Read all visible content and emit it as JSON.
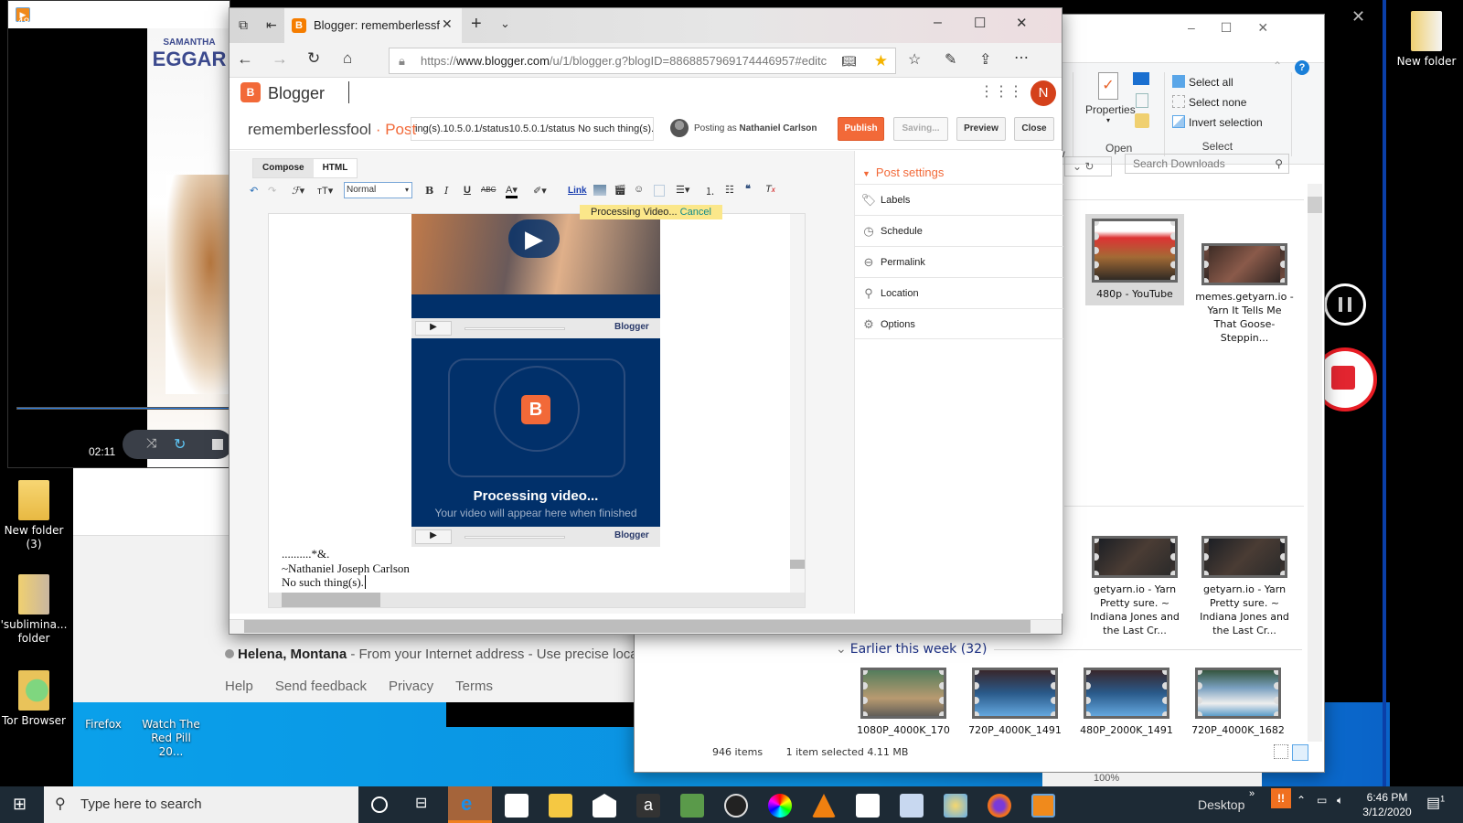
{
  "player": {
    "title": "480p - YouTube",
    "time": "02:11",
    "poster_text_1": "SAMANTHA",
    "poster_text_2": "EGGAR",
    "progress": 1.0
  },
  "desktop": {
    "left_icons": [
      {
        "label": "New folder (3)"
      },
      {
        "label": "'sublimina... folder"
      },
      {
        "label": "Tor Browser"
      }
    ],
    "bottom_icons": [
      {
        "label": "Firefox"
      },
      {
        "label": "Watch The Red Pill 20..."
      }
    ],
    "right_icons": [
      {
        "label": "New folder"
      }
    ]
  },
  "background_page": {
    "location_bold": "Helena, Montana",
    "location_rest": " - From your Internet address - Use precise locatio",
    "links": [
      "Help",
      "Send feedback",
      "Privacy",
      "Terms"
    ],
    "behind_text": [
      "..........",
      "~N",
      "No"
    ]
  },
  "edge": {
    "tab_title": "Blogger: rememberlessf",
    "url_prefix": "https://",
    "url_host": "www.blogger.com",
    "url_rest": "/u/1/blogger.g?blogID=886885796917444695​7#editc"
  },
  "blogger": {
    "brand": "Blogger",
    "avatar_letter": "N",
    "blog_name": "rememberlessfool",
    "separator": " · ",
    "post_label": "Post",
    "title_value": "ing(s).10.5.0.1/status10.5.0.1/status No such thing(s).",
    "posting_as_label": "Posting as",
    "posting_as_name": "Nathaniel Carlson",
    "buttons": {
      "publish": "Publish",
      "saving": "Saving...",
      "preview": "Preview",
      "close": "Close"
    },
    "tabs": {
      "compose": "Compose",
      "html": "HTML"
    },
    "toolbar": {
      "format_select": "Normal",
      "link": "Link"
    },
    "notice": {
      "text": "Processing Video...",
      "cancel": "Cancel"
    },
    "video": {
      "processing_title": "Processing video...",
      "processing_sub": "Your video will appear here when finished",
      "player_brand": "Blogger"
    },
    "body_lines": [
      "..........*&.",
      "~Nathaniel Joseph Carlson",
      "No such thing(s)."
    ],
    "sidebar": {
      "title": "Post settings",
      "items": [
        {
          "label": "Labels",
          "icon": "tag-icon"
        },
        {
          "label": "Schedule",
          "icon": "clock-icon"
        },
        {
          "label": "Permalink",
          "icon": "link-icon"
        },
        {
          "label": "Location",
          "icon": "pin-icon"
        },
        {
          "label": "Options",
          "icon": "gear-icon"
        }
      ]
    },
    "accent": "#f26938"
  },
  "explorer": {
    "ribbon": {
      "properties": "Properties",
      "open_group": "Open",
      "select_all": "Select all",
      "select_none": "Select none",
      "invert_selection": "Invert selection",
      "select_group": "Select",
      "view_group_fragment": "w"
    },
    "search_placeholder": "Search Downloads",
    "files_top": [
      {
        "label": "480p - YouTube",
        "selected": true
      },
      {
        "label": "memes.getyarn.io - Yarn  It Tells Me That Goose-Steppin..."
      },
      {
        "label": "getyarn.io - Yarn Pretty sure. ~ Indiana Jones and the Last Cr..."
      },
      {
        "label": "getyarn.io - Yarn Pretty sure. ~ Indiana Jones and the Last Cr..."
      }
    ],
    "group_header": "Earlier this week (32)",
    "files_week": [
      {
        "label": "1080P_4000K_170"
      },
      {
        "label": "720P_4000K_1491"
      },
      {
        "label": "480P_2000K_1491"
      },
      {
        "label": "720P_4000K_1682"
      }
    ],
    "status": {
      "items": "946 items",
      "selected": "1 item selected  4.11 MB"
    },
    "zoom_level": "100%"
  },
  "taskbar": {
    "search_placeholder": "Type here to search",
    "desktop_label": "Desktop",
    "time": "6:46 PM",
    "date": "3/12/2020",
    "notification_count": "1"
  }
}
